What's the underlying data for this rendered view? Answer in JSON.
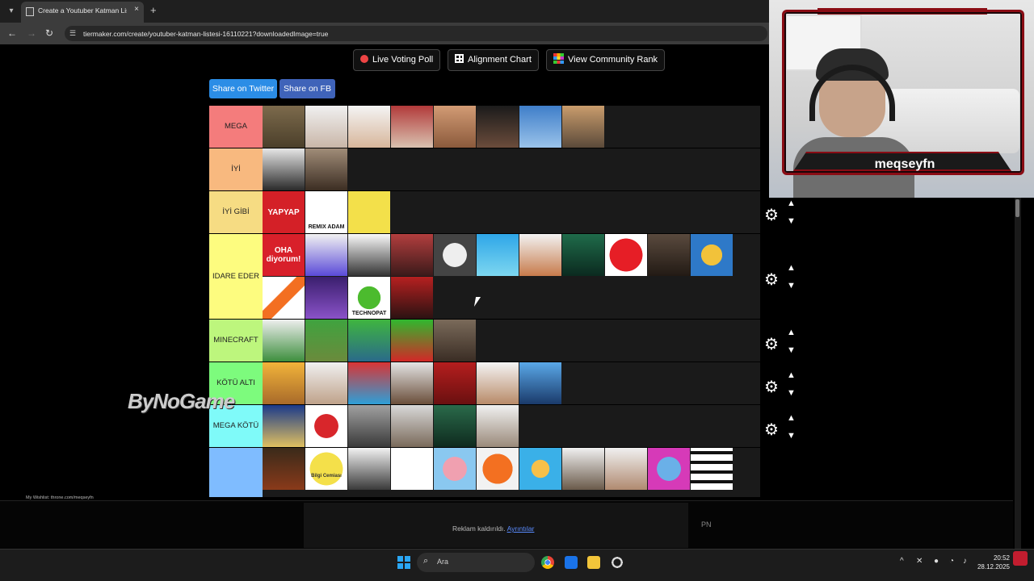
{
  "browser": {
    "tab_title": "Create a Youtuber Katman Listesi",
    "address": "tiermaker.com/create/youtuber-katman-listesi-16110221?downloadedImage=true",
    "new_tab_glyph": "+",
    "close_glyph": "×"
  },
  "toolbar": {
    "live_voting_label": "Live Voting Poll",
    "alignment_label": "Alignment Chart",
    "community_rank_label": "View Community Rank"
  },
  "share": {
    "twitter_label": "Share on Twitter",
    "fb_label": "Share on FB",
    "twitter_color": "#2b8de6",
    "fb_color": "#3f63b9"
  },
  "tiers": [
    {
      "label": "MEGA",
      "color": "#f47c7c"
    },
    {
      "label": "İYİ",
      "color": "#f8b97f"
    },
    {
      "label": "İYİ GİBİ",
      "color": "#f6dc83"
    },
    {
      "label": "IDARE EDER",
      "color": "#fdfc7f"
    },
    {
      "label": "MINECRAFT",
      "color": "#bdf67d"
    },
    {
      "label": "KÖTÜ ALTI",
      "color": "#7dfb7d"
    },
    {
      "label": "MEGA KÖTÜ",
      "color": "#7ffaf9"
    },
    {
      "label": "",
      "color": "#7fbcff"
    }
  ],
  "thumb_texts": {
    "yapyap": "YAPYAP",
    "remix": "REMIX ADAM",
    "oha": "OHA diyorum!",
    "technopat": "TECHNOPAT",
    "bilgi": "Bilgi Cemiası"
  },
  "overlay": {
    "logo": "ByNoGame",
    "wishlist": "My Wishlist: throne.com/meqseyfn",
    "streamer_name": "meqseyfn"
  },
  "ad": {
    "text": "Reklam kaldırıldı.",
    "link": "Ayrıntılar",
    "corner": "PN"
  },
  "taskbar": {
    "search_placeholder": "Ara",
    "time": "20:52",
    "date": "28.12.2025"
  }
}
